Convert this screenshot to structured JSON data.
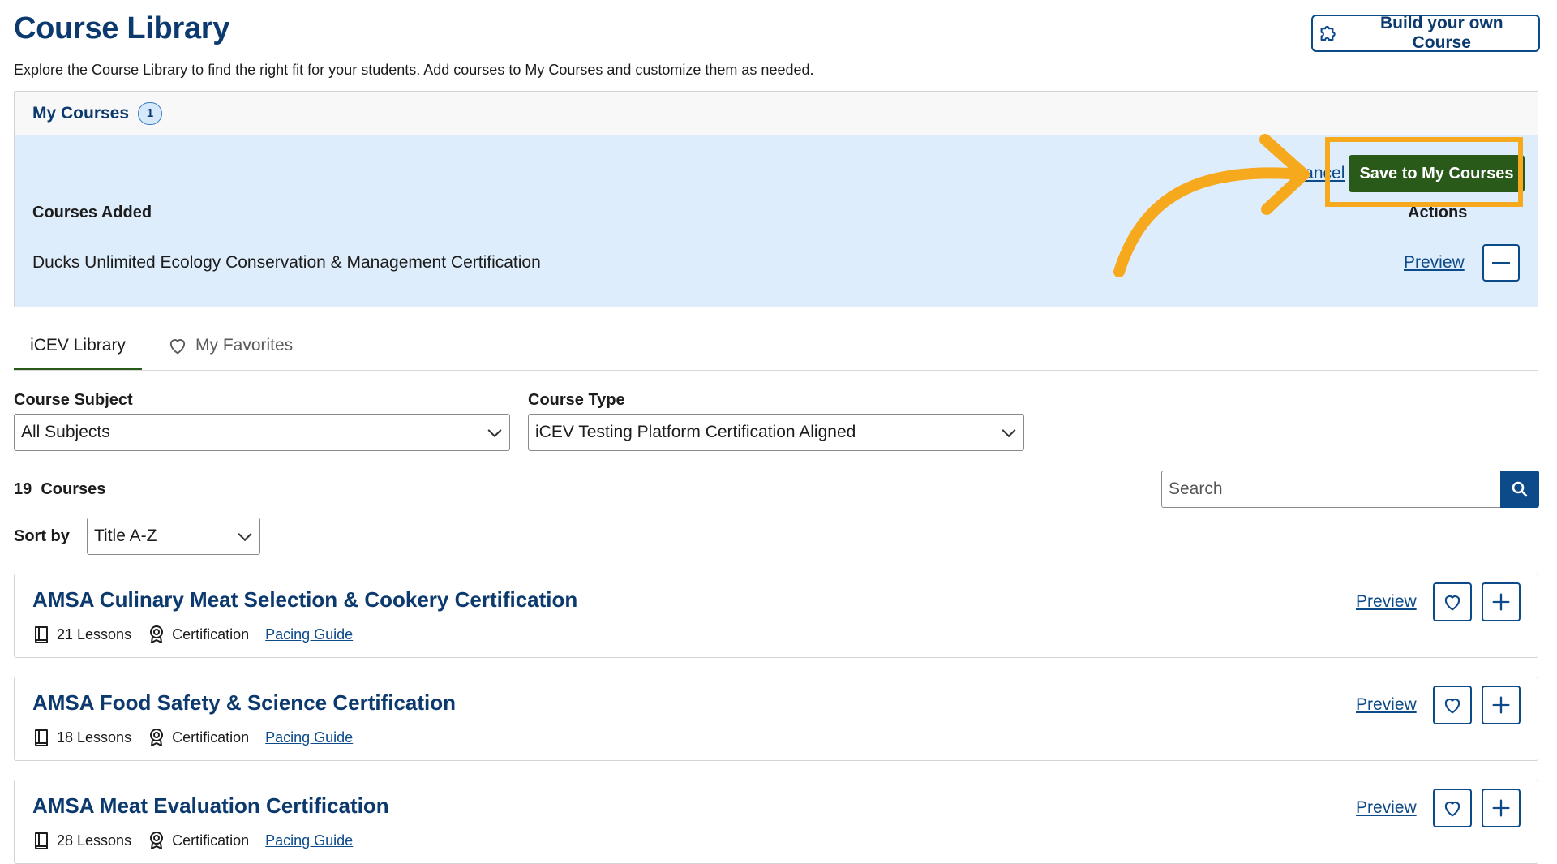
{
  "header": {
    "title": "Course Library",
    "subtitle": "Explore the Course Library to find the right fit for your students. Add courses to My Courses and customize them as needed.",
    "build_button": "Build your own Course"
  },
  "my_courses": {
    "tab_label": "My Courses",
    "count": "1",
    "cancel_label": "Cancel",
    "save_label": "Save to My Courses",
    "courses_added_label": "Courses Added",
    "actions_label": "Actions",
    "items": [
      {
        "name": "Ducks Unlimited Ecology Conservation & Management Certification",
        "preview_label": "Preview"
      }
    ]
  },
  "tabs": [
    {
      "label": "iCEV Library",
      "active": true
    },
    {
      "label": "My Favorites",
      "active": false,
      "icon": "heart-icon"
    }
  ],
  "filters": {
    "subject_label": "Course Subject",
    "subject_value": "All Subjects",
    "type_label": "Course Type",
    "type_value": "iCEV Testing Platform Certification Aligned"
  },
  "results": {
    "count_text": "19  Courses",
    "search_placeholder": "Search",
    "sort_label": "Sort by",
    "sort_value": "Title A-Z"
  },
  "courses": [
    {
      "title": "AMSA Culinary Meat Selection & Cookery Certification",
      "lessons": "21 Lessons",
      "type": "Certification",
      "pacing": "Pacing Guide",
      "preview": "Preview"
    },
    {
      "title": "AMSA Food Safety & Science Certification",
      "lessons": "18 Lessons",
      "type": "Certification",
      "pacing": "Pacing Guide",
      "preview": "Preview"
    },
    {
      "title": "AMSA Meat Evaluation Certification",
      "lessons": "28 Lessons",
      "type": "Certification",
      "pacing": "Pacing Guide",
      "preview": "Preview"
    }
  ],
  "colors": {
    "brand_blue": "#0c3a6e",
    "link_blue": "#0c4a8a",
    "save_green": "#2a5a1a",
    "highlight_orange": "#f7a91e",
    "panel_blue": "#deedfb"
  }
}
